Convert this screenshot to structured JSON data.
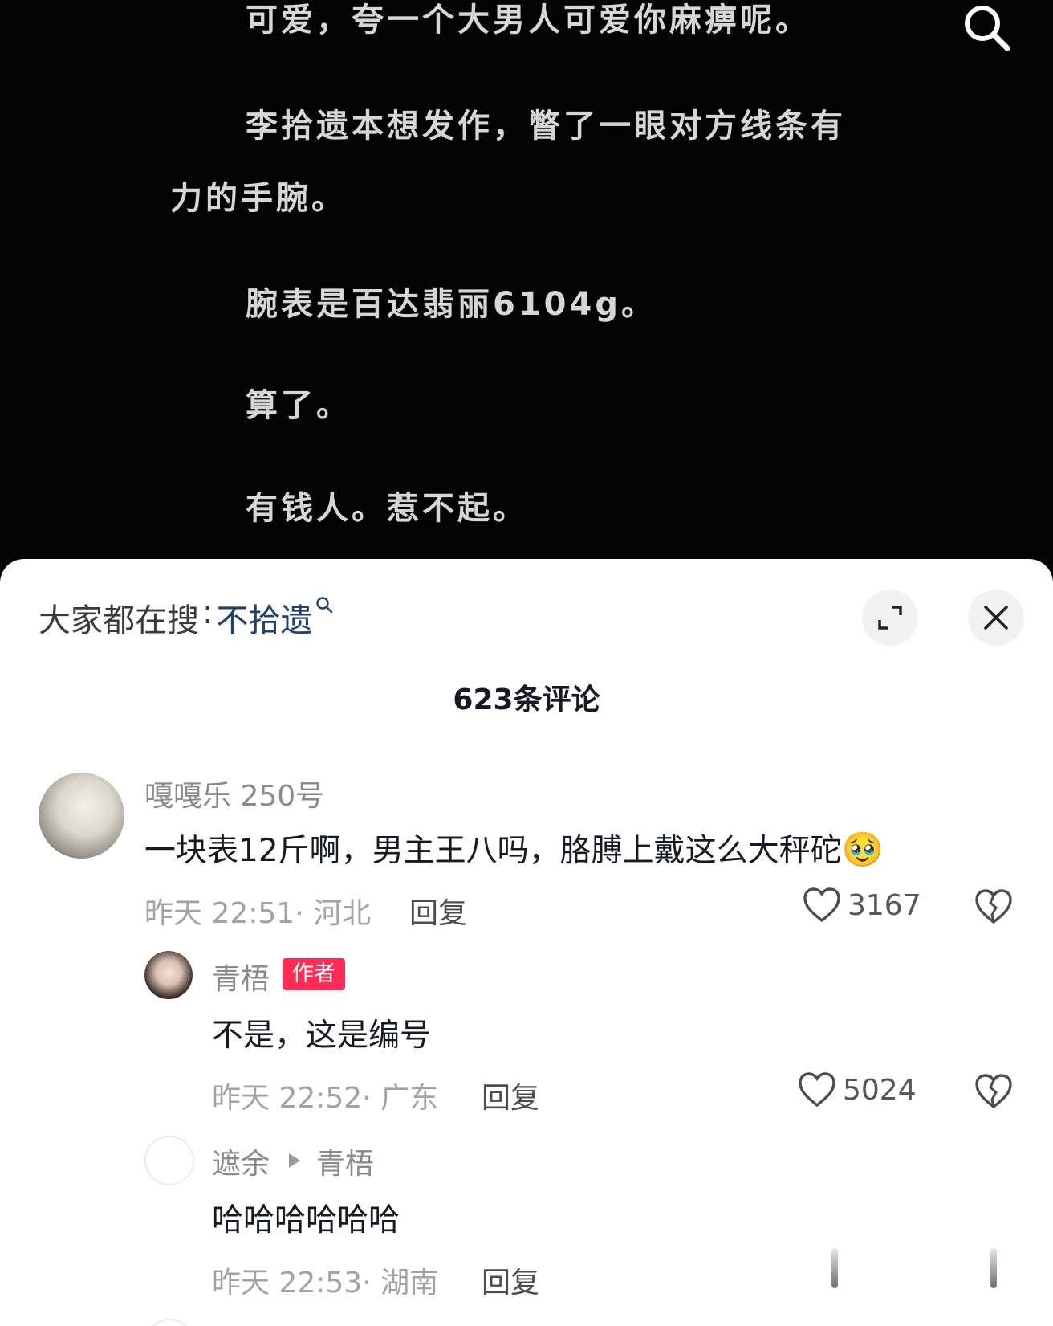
{
  "reader": {
    "paragraphs": [
      "可爱，夸一个大男人可爱你麻痹呢。",
      "李拾遗本想发作，瞥了一眼对方线条有",
      "力的手腕。",
      "腕表是百达翡丽6104g。",
      "算了。",
      "有钱人。惹不起。"
    ],
    "search_icon": "search-icon"
  },
  "sheet": {
    "hot_search_label": "大家都在搜",
    "hot_search_sep": ":",
    "hot_search_term": "不拾遗",
    "expand_icon": "expand-icon",
    "close_icon": "close-icon",
    "comment_count_title": "623条评论"
  },
  "comments": [
    {
      "username": "嘎嘎乐 250号",
      "text": "一块表12斤啊，男主王八吗，胳膊上戴这么大秤砣",
      "emoji": "🥹",
      "time": "昨天 22:51",
      "location": "· 河北",
      "reply_label": "回复",
      "likes": "3167"
    },
    {
      "username": "青梧",
      "author_tag": "作者",
      "text": "不是，这是编号",
      "time": "昨天 22:52",
      "location": "· 广东",
      "reply_label": "回复",
      "likes": "5024"
    },
    {
      "username": "遮余",
      "reply_to": "青梧",
      "text": "哈哈哈哈哈哈",
      "time": "昨天 22:53",
      "location": "· 湖南",
      "reply_label": "回复"
    }
  ],
  "colors": {
    "accent_red": "#fe2c55",
    "link_blue": "#20406e"
  }
}
